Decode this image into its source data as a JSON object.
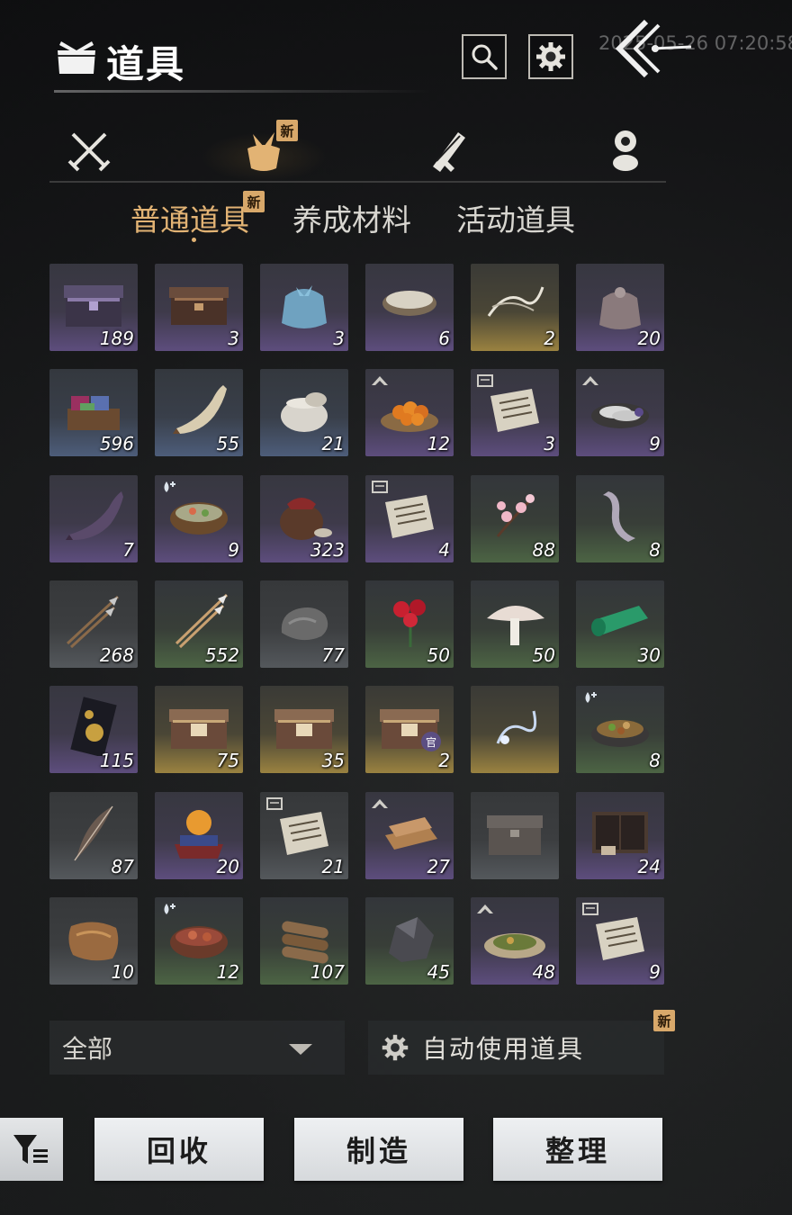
{
  "header": {
    "title": "道具",
    "timestamp": "2025-05-26 07:20:58",
    "search_icon": "search-icon",
    "settings_icon": "gear-icon",
    "back_icon": "back-arrow-icon"
  },
  "category_tabs": [
    {
      "icon": "crossed-swords-icon",
      "active": false
    },
    {
      "icon": "bundle-bag-icon",
      "active": true,
      "badge": "新"
    },
    {
      "icon": "scroll-icon",
      "active": false
    },
    {
      "icon": "token-icon",
      "active": false
    }
  ],
  "sub_tabs": {
    "common": {
      "label": "普通道具",
      "badge": "新"
    },
    "materials": {
      "label": "养成材料"
    },
    "event": {
      "label": "活动道具"
    }
  },
  "items": [
    {
      "icon": "ornate-chest-icon",
      "count": "189",
      "rarity": "purple"
    },
    {
      "icon": "wooden-chest-icon",
      "count": "3",
      "rarity": "purple"
    },
    {
      "icon": "cloth-pouch-icon",
      "count": "3",
      "rarity": "purple"
    },
    {
      "icon": "rice-bowl-icon",
      "count": "6",
      "rarity": "purple"
    },
    {
      "icon": "dragon-spirit-icon",
      "count": "2",
      "rarity": "gold"
    },
    {
      "icon": "sack-icon",
      "count": "20",
      "rarity": "purple"
    },
    {
      "icon": "dye-box-icon",
      "count": "596",
      "rarity": "blue"
    },
    {
      "icon": "horn-icon",
      "count": "55",
      "rarity": "blue"
    },
    {
      "icon": "clay-pot-icon",
      "count": "21",
      "rarity": "blue"
    },
    {
      "icon": "orange-plate-icon",
      "count": "12",
      "rarity": "purple",
      "mark": "level-up-mark-icon"
    },
    {
      "icon": "recipe-paper-icon",
      "count": "3",
      "rarity": "purple",
      "mark": "recipe-mark-icon"
    },
    {
      "icon": "fish-plate-icon",
      "count": "9",
      "rarity": "purple",
      "mark": "level-up-mark-icon"
    },
    {
      "icon": "dark-horn-icon",
      "count": "7",
      "rarity": "purple"
    },
    {
      "icon": "soup-bowl-icon",
      "count": "9",
      "rarity": "purple",
      "mark": "water-mark-icon"
    },
    {
      "icon": "wine-jar-icon",
      "count": "323",
      "rarity": "purple"
    },
    {
      "icon": "recipe-paper-icon",
      "count": "4",
      "rarity": "purple",
      "mark": "recipe-mark-icon"
    },
    {
      "icon": "plum-blossom-icon",
      "count": "88",
      "rarity": "green"
    },
    {
      "icon": "cloth-strip-icon",
      "count": "8",
      "rarity": "green"
    },
    {
      "icon": "arrows-icon",
      "count": "268",
      "rarity": "gray"
    },
    {
      "icon": "bright-arrows-icon",
      "count": "552",
      "rarity": "green"
    },
    {
      "icon": "stone-icon",
      "count": "77",
      "rarity": "gray"
    },
    {
      "icon": "red-flower-icon",
      "count": "50",
      "rarity": "green"
    },
    {
      "icon": "mushroom-icon",
      "count": "50",
      "rarity": "green"
    },
    {
      "icon": "jade-scroll-icon",
      "count": "30",
      "rarity": "green"
    },
    {
      "icon": "gold-pattern-card-icon",
      "count": "115",
      "rarity": "purple"
    },
    {
      "icon": "treasure-chest-icon",
      "count": "75",
      "rarity": "gold"
    },
    {
      "icon": "treasure-chest-icon",
      "count": "35",
      "rarity": "gold"
    },
    {
      "icon": "treasure-chest-icon",
      "count": "2",
      "rarity": "gold",
      "badge": "官"
    },
    {
      "icon": "spirit-wisp-icon",
      "count": "",
      "rarity": "gold"
    },
    {
      "icon": "stir-fry-icon",
      "count": "8",
      "rarity": "green",
      "mark": "water-mark-icon"
    },
    {
      "icon": "feather-icon",
      "count": "87",
      "rarity": "gray"
    },
    {
      "icon": "orb-pedestal-icon",
      "count": "20",
      "rarity": "purple"
    },
    {
      "icon": "recipe-paper-icon",
      "count": "21",
      "rarity": "gray",
      "mark": "recipe-mark-icon"
    },
    {
      "icon": "flatbread-icon",
      "count": "27",
      "rarity": "purple",
      "mark": "level-up-mark-icon"
    },
    {
      "icon": "iron-chest-icon",
      "count": "",
      "rarity": "gray"
    },
    {
      "icon": "cabinet-icon",
      "count": "24",
      "rarity": "purple"
    },
    {
      "icon": "fur-pelt-icon",
      "count": "10",
      "rarity": "gray"
    },
    {
      "icon": "meat-stew-icon",
      "count": "12",
      "rarity": "green",
      "mark": "water-mark-icon"
    },
    {
      "icon": "firewood-icon",
      "count": "107",
      "rarity": "green"
    },
    {
      "icon": "ore-icon",
      "count": "45",
      "rarity": "green"
    },
    {
      "icon": "herb-dish-icon",
      "count": "48",
      "rarity": "purple",
      "mark": "level-up-mark-icon"
    },
    {
      "icon": "recipe-paper-icon",
      "count": "9",
      "rarity": "purple",
      "mark": "recipe-mark-icon"
    }
  ],
  "filter": {
    "label": "全部"
  },
  "auto_use": {
    "label": "自动使用道具",
    "badge": "新"
  },
  "buttons": {
    "recycle": "回收",
    "craft": "制造",
    "arrange": "整理"
  },
  "colors": {
    "accent": "#e2b374",
    "badge_bg": "#d8a86a",
    "purple_rarity": "#5d4d7d",
    "blue_rarity": "#4d5d7a",
    "green_rarity": "#4c6444",
    "gold_rarity": "#9a8240"
  }
}
